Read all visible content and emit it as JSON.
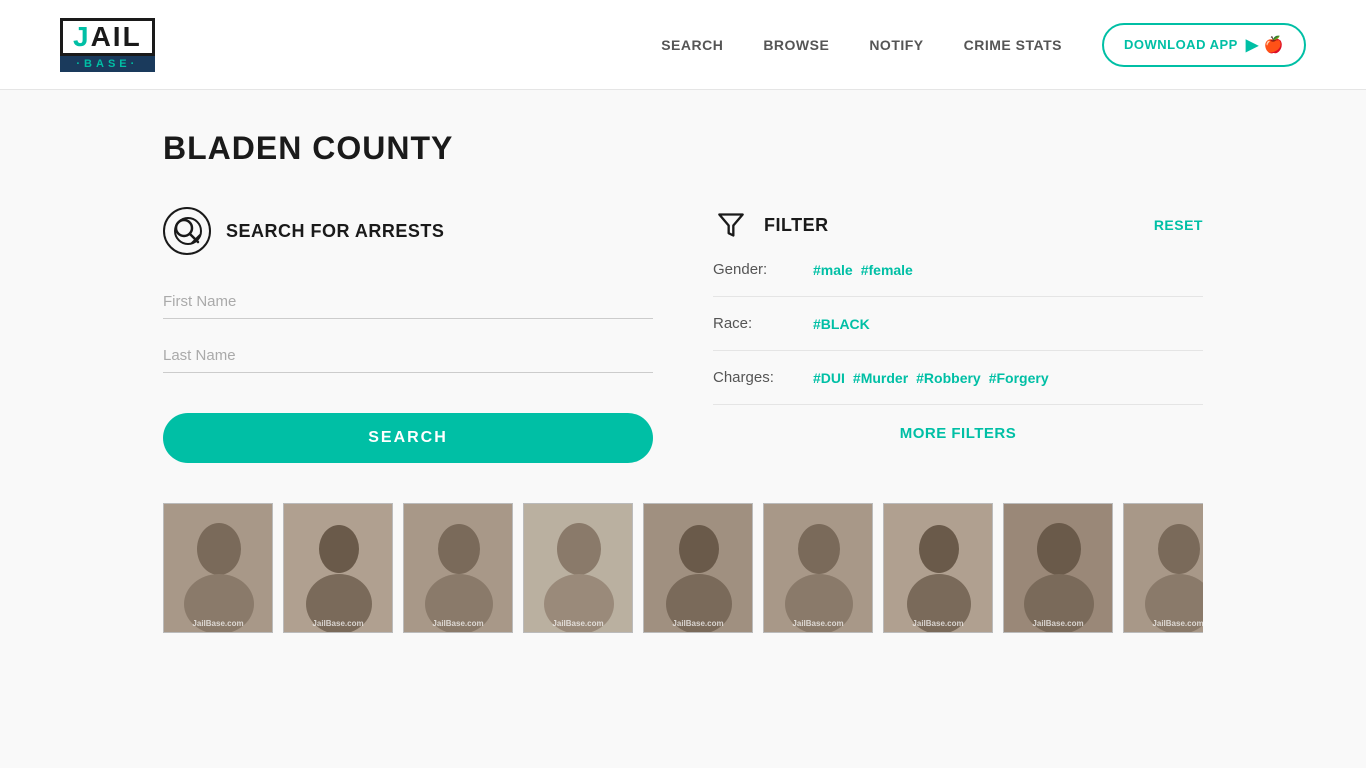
{
  "header": {
    "logo": {
      "jail_text": "JAIL",
      "base_text": "·BASE·"
    },
    "nav": {
      "links": [
        {
          "label": "SEARCH",
          "id": "search"
        },
        {
          "label": "BROWSE",
          "id": "browse"
        },
        {
          "label": "NOTIFY",
          "id": "notify"
        },
        {
          "label": "CRIME STATS",
          "id": "crime-stats"
        }
      ],
      "download_btn": "DOWNLOAD APP"
    }
  },
  "page": {
    "title": "BLADEN COUNTY"
  },
  "search_section": {
    "title": "SEARCH FOR ARRESTS",
    "first_name_placeholder": "First Name",
    "last_name_placeholder": "Last Name",
    "button_label": "SEARCH"
  },
  "filter_section": {
    "title": "FILTER",
    "reset_label": "RESET",
    "gender_label": "Gender:",
    "gender_tags": [
      "#male",
      "#female"
    ],
    "race_label": "Race:",
    "race_tags": [
      "#BLACK"
    ],
    "charges_label": "Charges:",
    "charges_tags": [
      "#DUI",
      "#Murder",
      "#Robbery",
      "#Forgery"
    ],
    "more_filters_label": "MORE FILTERS"
  },
  "mugshots": {
    "count": 9,
    "watermark": "JailBase.com"
  },
  "colors": {
    "accent": "#00bfa5",
    "dark": "#1a1a1a",
    "navy": "#1a3a5c"
  }
}
